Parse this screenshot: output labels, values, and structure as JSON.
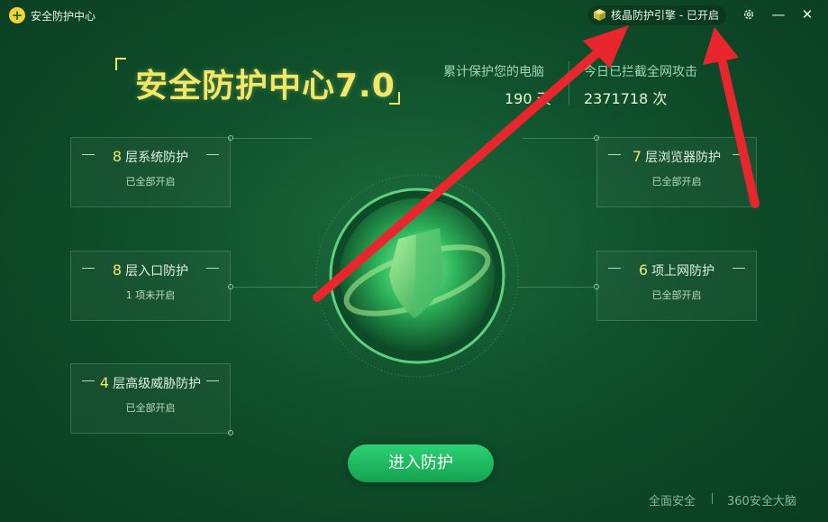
{
  "titlebar": {
    "logo_glyph": "+",
    "title": "安全防护中心",
    "engine_status": "核晶防护引擎 - 已开启",
    "icons": [
      "cube-icon",
      "gear-icon",
      "minimize-icon",
      "close-icon"
    ]
  },
  "hero": {
    "title": "安全防护中心7.0"
  },
  "stats": {
    "protect_label": "累计保护您的电脑",
    "protect_value": "190  天",
    "block_label": "今日已拦截全网攻击",
    "block_value": "2371718 次"
  },
  "cards": [
    {
      "num": "8",
      "title": "层系统防护",
      "status": "已全部开启"
    },
    {
      "num": "8",
      "title": "层入口防护",
      "status": "1 项未开启"
    },
    {
      "num": "4",
      "title": "层高级威胁防护",
      "status": "已全部开启"
    },
    {
      "num": "7",
      "title": "层浏览器防护",
      "status": "已全部开启"
    },
    {
      "num": "6",
      "title": "项上网防护",
      "status": "已全部开启"
    }
  ],
  "enter_button": "进入防护",
  "footer": {
    "link1": "全面安全",
    "link2": "360安全大脑"
  },
  "colors": {
    "accent": "#f1e86a",
    "button": "#1fbf61",
    "arrow": "#e8262d"
  }
}
